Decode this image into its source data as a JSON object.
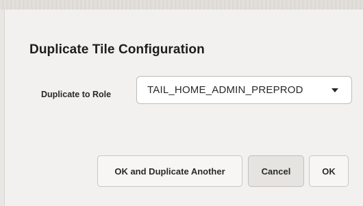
{
  "dialog": {
    "title": "Duplicate Tile Configuration",
    "field": {
      "label": "Duplicate to Role",
      "selected_value": "TAIL_HOME_ADMIN_PREPROD"
    },
    "buttons": {
      "ok_and_duplicate_label": "OK and Duplicate Another",
      "cancel_label": "Cancel",
      "ok_label": "OK"
    }
  },
  "colors": {
    "dialog_background": "#f2f1ef",
    "select_background": "#ffffff",
    "border": "#c9c6c1",
    "text": "#2b2926"
  },
  "icons": {
    "select_caret": "caret-down-icon"
  }
}
